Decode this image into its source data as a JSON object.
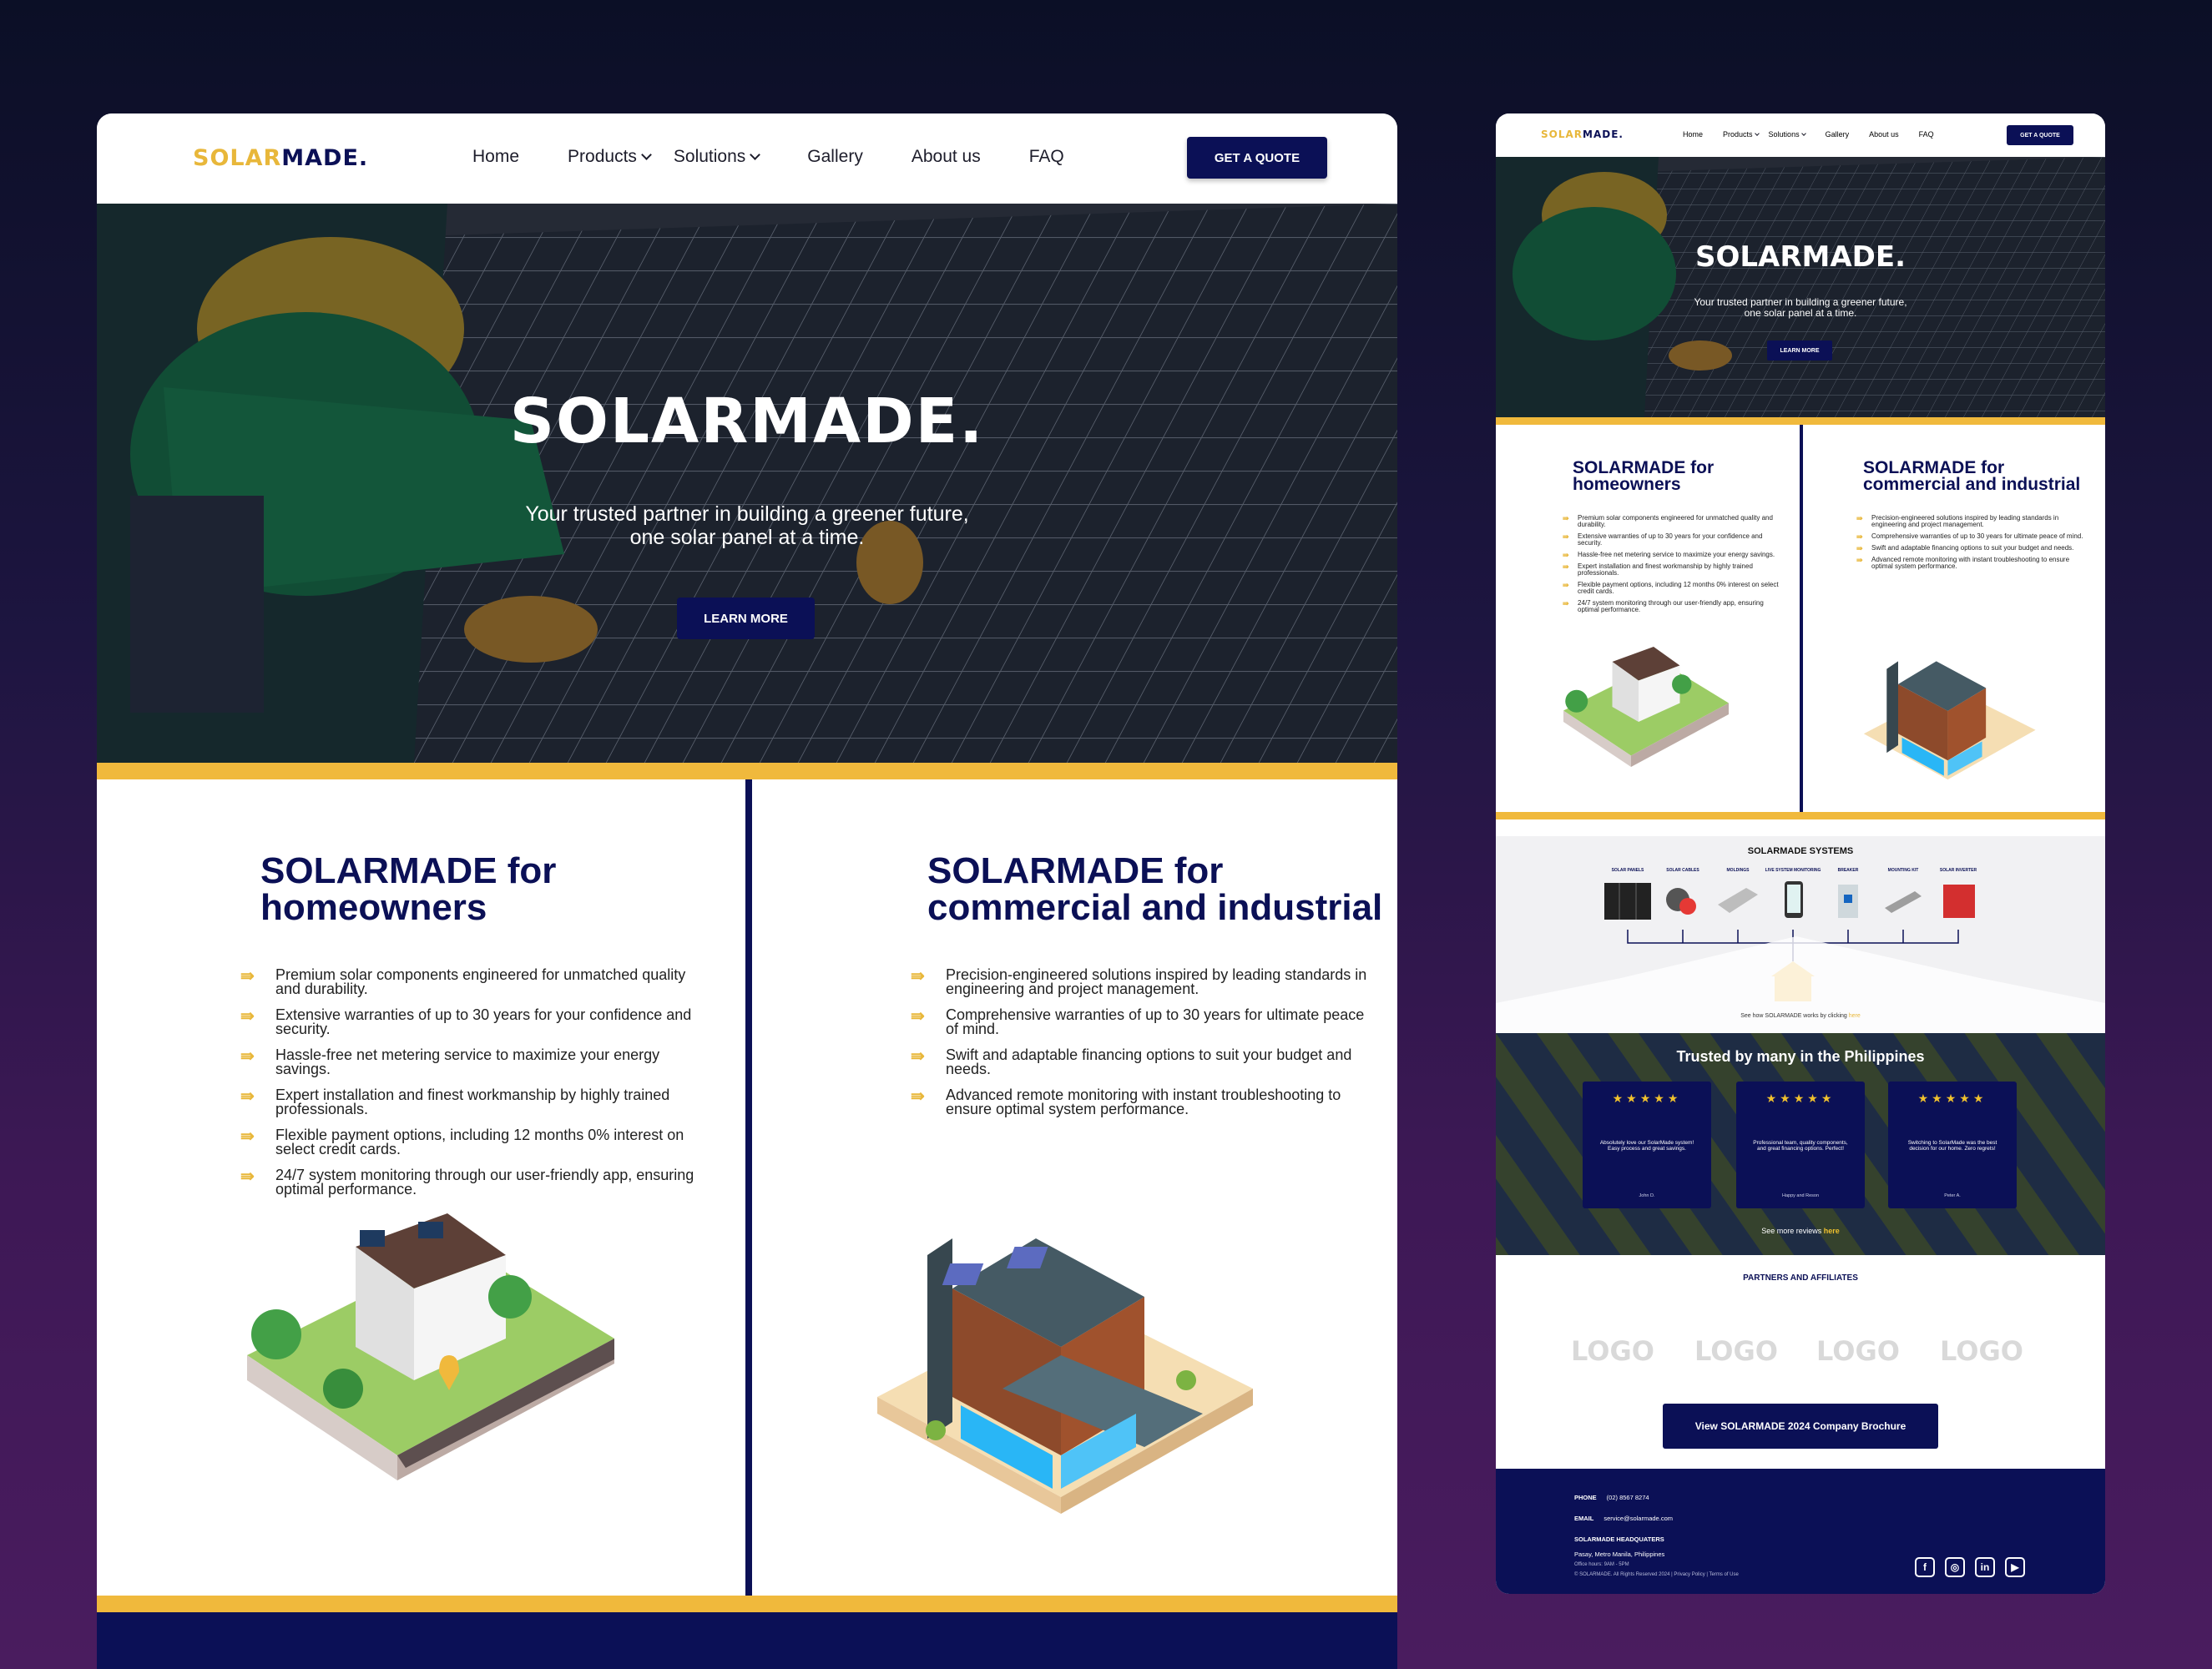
{
  "brand": {
    "logo_part1": "SOLAR",
    "logo_part2": "MADE.",
    "hero_title": "SOLARMADE."
  },
  "colors": {
    "navy": "#0b1056",
    "accent": "#f0b93c",
    "background": "#1d1540"
  },
  "nav": {
    "items": [
      "Home",
      "Products",
      "Solutions",
      "Gallery",
      "About us",
      "FAQ"
    ],
    "quote_label": "GET A QUOTE"
  },
  "hero": {
    "subtitle_line1": "Your trusted partner in building a greener future,",
    "subtitle_line2": "one solar panel at a time.",
    "cta_label": "LEARN MORE"
  },
  "homeowners": {
    "title_line1": "SOLARMADE for",
    "title_line2": "homeowners",
    "bullets": [
      "Premium solar components engineered for unmatched quality and durability.",
      "Extensive warranties of up to 30 years for your confidence and security.",
      "Hassle-free net metering service to maximize your energy savings.",
      "Expert installation and finest workmanship by highly trained professionals.",
      "Flexible payment options, including 12 months 0% interest on select credit cards.",
      "24/7 system monitoring through our user-friendly app, ensuring optimal performance."
    ]
  },
  "commercial": {
    "title_line1": "SOLARMADE for",
    "title_line2": "commercial and industrial",
    "bullets": [
      "Precision-engineered solutions inspired by leading standards in engineering and project management.",
      "Comprehensive warranties of up to 30 years for ultimate peace of mind.",
      "Swift and adaptable financing options to suit your budget and needs.",
      "Advanced remote monitoring with instant troubleshooting to ensure optimal system performance."
    ]
  },
  "systems": {
    "title": "SOLARMADE SYSTEMS",
    "items": [
      "SOLAR PANELS",
      "SOLAR CABLES",
      "MOLDINGS",
      "LIVE SYSTEM MONITORING",
      "BREAKER",
      "MOUNTING KIT",
      "SOLAR INVERTER"
    ],
    "caption": "See how SOLARMADE works by clicking ",
    "caption_link": "here"
  },
  "reviews": {
    "title": "Trusted by many in the Philippines",
    "stars": "★★★★★",
    "cards": [
      {
        "text": "Absolutely love our SolarMade system! Easy process and great savings.",
        "author": "John D."
      },
      {
        "text": "Professional team, quality components, and great financing options. Perfect!",
        "author": "Happy and Reson"
      },
      {
        "text": "Switching to SolarMade was the best decision for our home. Zero regrets!",
        "author": "Peter A."
      }
    ],
    "more_text": "See more reviews ",
    "more_link": "here"
  },
  "partners": {
    "title": "PARTNERS AND AFFILIATES",
    "logos": [
      "LOGO",
      "LOGO",
      "LOGO",
      "LOGO"
    ],
    "brochure_label": "View SOLARMADE 2024 Company Brochure"
  },
  "footer": {
    "phone_label": "PHONE",
    "phone": "(02) 8567 8274",
    "email_label": "EMAIL",
    "email": "service@solarmade.com",
    "hq_label": "SOLARMADE HEADQUATERS",
    "address": "Pasay, Metro Manila, Philippines",
    "hours": "Office hours: 9AM - 5PM",
    "copyright": "© SOLARMADE. All Rights Reserved 2024 | Privacy Policy | Terms of Use",
    "social": [
      "facebook-icon",
      "instagram-icon",
      "linkedin-icon",
      "youtube-icon"
    ]
  }
}
